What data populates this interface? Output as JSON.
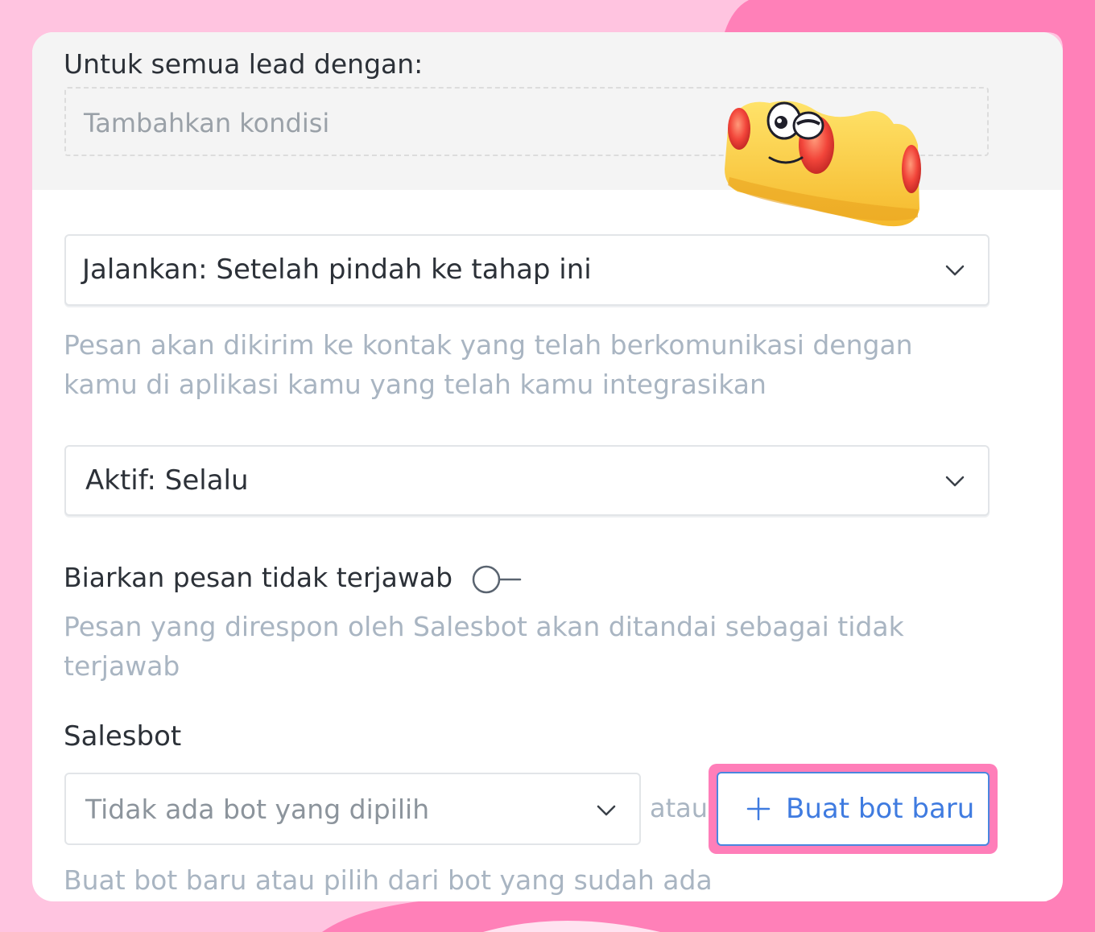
{
  "conditions": {
    "label": "Untuk semua lead dengan:",
    "placeholder": "Tambahkan kondisi"
  },
  "run_select": {
    "value": "Jalankan: Setelah pindah ke tahap ini",
    "hint": "Pesan akan dikirim ke kontak yang telah berkomunikasi dengan kamu di aplikasi kamu yang telah kamu integrasikan"
  },
  "active_select": {
    "value": "Aktif: Selalu"
  },
  "unanswered": {
    "label": "Biarkan pesan tidak terjawab",
    "toggle_on": false,
    "hint": "Pesan yang direspon oleh Salesbot akan ditandai sebagai tidak terjawab"
  },
  "salesbot": {
    "label": "Salesbot",
    "select_value": "Tidak ada bot yang dipilih",
    "or_text": "atau",
    "new_bot_label": "Buat bot baru",
    "hint": "Buat bot baru atau pilih dari bot yang sudah ada"
  },
  "colors": {
    "accent": "#3f7be0",
    "highlight": "#ff7eb9",
    "background": "#ffc4e0",
    "hint_text": "#a9b5c2"
  },
  "icons": [
    "chevron-down-icon",
    "plus-icon",
    "toggle-switch",
    "crown-mascot-sticker"
  ]
}
